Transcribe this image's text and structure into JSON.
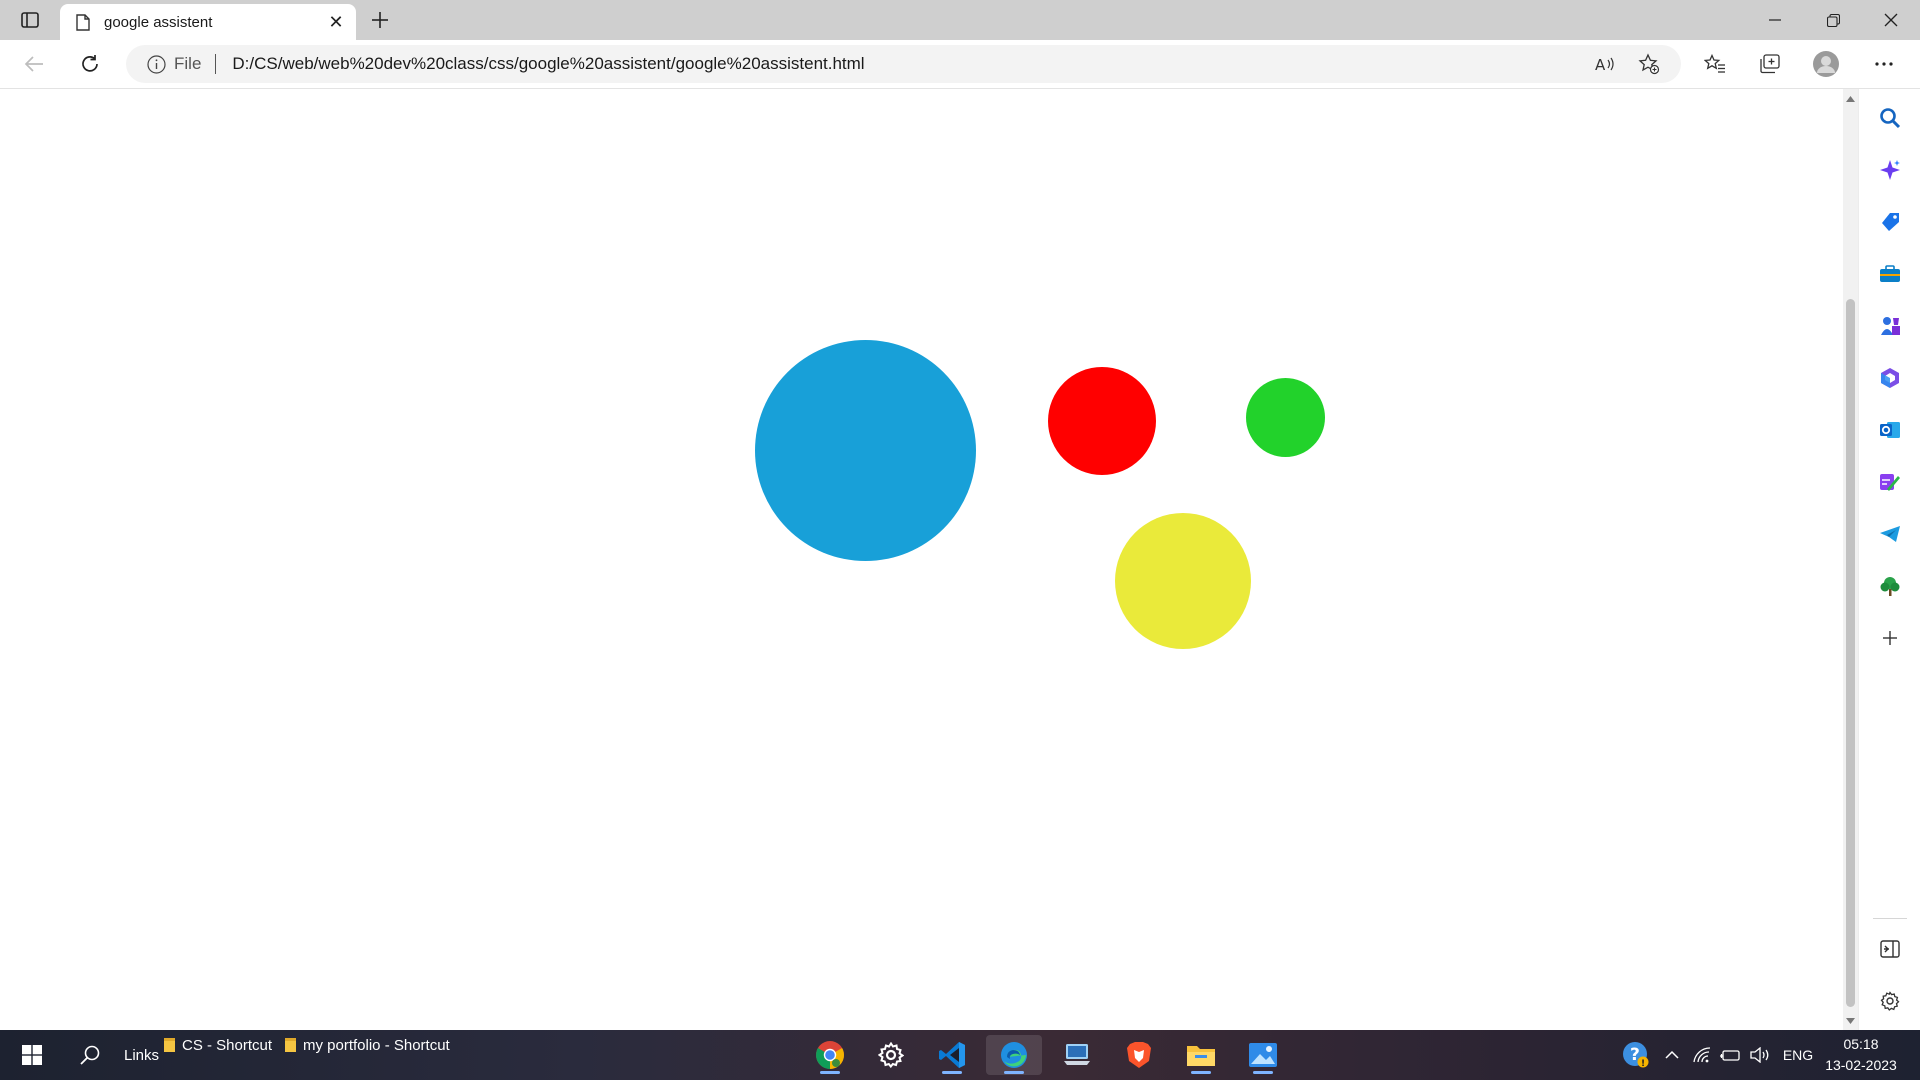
{
  "browser": {
    "tab": {
      "title": "google assistent"
    },
    "address_bar": {
      "scheme_label": "File",
      "url": "D:/CS/web/web%20dev%20class/css/google%20assistent/google%20assistent.html"
    }
  },
  "page": {
    "circles": [
      {
        "name": "blue",
        "color": "#18a0d8"
      },
      {
        "name": "red",
        "color": "#ff0000"
      },
      {
        "name": "green",
        "color": "#22d22b"
      },
      {
        "name": "yellow",
        "color": "#eaea3a"
      }
    ]
  },
  "sidebar": {
    "icons": [
      "search-icon",
      "copilot-icon",
      "shopping-tag-icon",
      "tools-icon",
      "games-icon",
      "microsoft-365-icon",
      "outlook-icon",
      "designer-icon",
      "telegram-icon",
      "tree-icon",
      "add-icon"
    ],
    "bottom_icons": [
      "hide-sidebar-icon",
      "settings-icon"
    ]
  },
  "taskbar": {
    "links_label": "Links",
    "shortcuts": [
      {
        "label": "CS - Shortcut"
      },
      {
        "label": "my portfolio - Shortcut"
      }
    ],
    "apps": [
      "chrome",
      "settings",
      "vscode",
      "edge",
      "remote-desktop",
      "brave",
      "file-explorer",
      "photos"
    ],
    "tray": {
      "language": "ENG",
      "time": "05:18",
      "date": "13-02-2023"
    }
  }
}
